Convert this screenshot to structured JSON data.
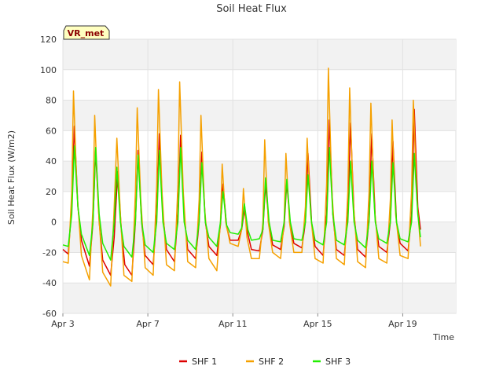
{
  "chart_data": {
    "type": "line",
    "title": "Soil Heat Flux",
    "xlabel": "Time",
    "ylabel": "Soil Heat Flux (W/m2)",
    "badge": "VR_met",
    "xlim": [
      "2024-03-03",
      "2024-03-21 12:00"
    ],
    "ylim": [
      -60,
      120
    ],
    "yticks": [
      -60,
      -40,
      -20,
      0,
      20,
      40,
      60,
      80,
      100,
      120
    ],
    "xticks": [
      {
        "date": "2024-03-03",
        "label": "Apr 3"
      },
      {
        "date": "2024-03-07",
        "label": "Apr 7"
      },
      {
        "date": "2024-03-11",
        "label": "Apr 11"
      },
      {
        "date": "2024-03-15",
        "label": "Apr 15"
      },
      {
        "date": "2024-03-19",
        "label": "Apr 19"
      }
    ],
    "grid": true,
    "banded_background": true,
    "legend_position": "bottom-center",
    "series": [
      {
        "name": "SHF 1",
        "color": "#dd0000",
        "points": [
          [
            "2024-03-03 00:00",
            -18
          ],
          [
            "2024-03-03 06:00",
            -21
          ],
          [
            "2024-03-03 10:00",
            10
          ],
          [
            "2024-03-03 13:00",
            63
          ],
          [
            "2024-03-03 17:00",
            10
          ],
          [
            "2024-03-03 21:00",
            -12
          ],
          [
            "2024-03-04 06:00",
            -29
          ],
          [
            "2024-03-04 10:00",
            0
          ],
          [
            "2024-03-04 13:00",
            47
          ],
          [
            "2024-03-04 17:00",
            0
          ],
          [
            "2024-03-04 21:00",
            -25
          ],
          [
            "2024-03-05 06:00",
            -35
          ],
          [
            "2024-03-05 10:00",
            -10
          ],
          [
            "2024-03-05 14:00",
            33
          ],
          [
            "2024-03-05 18:00",
            -5
          ],
          [
            "2024-03-05 22:00",
            -28
          ],
          [
            "2024-03-06 06:00",
            -35
          ],
          [
            "2024-03-06 10:00",
            0
          ],
          [
            "2024-03-06 13:00",
            47
          ],
          [
            "2024-03-06 17:00",
            0
          ],
          [
            "2024-03-06 21:00",
            -22
          ],
          [
            "2024-03-07 06:00",
            -28
          ],
          [
            "2024-03-07 10:00",
            5
          ],
          [
            "2024-03-07 13:00",
            58
          ],
          [
            "2024-03-07 17:00",
            5
          ],
          [
            "2024-03-07 21:00",
            -18
          ],
          [
            "2024-03-08 06:00",
            -26
          ],
          [
            "2024-03-08 10:00",
            5
          ],
          [
            "2024-03-08 13:00",
            57
          ],
          [
            "2024-03-08 17:00",
            5
          ],
          [
            "2024-03-08 21:00",
            -18
          ],
          [
            "2024-03-09 06:00",
            -24
          ],
          [
            "2024-03-09 10:00",
            0
          ],
          [
            "2024-03-09 13:00",
            46
          ],
          [
            "2024-03-09 17:00",
            0
          ],
          [
            "2024-03-09 21:00",
            -16
          ],
          [
            "2024-03-10 06:00",
            -22
          ],
          [
            "2024-03-10 10:00",
            -2
          ],
          [
            "2024-03-10 13:00",
            25
          ],
          [
            "2024-03-10 17:00",
            -3
          ],
          [
            "2024-03-10 21:00",
            -12
          ],
          [
            "2024-03-11 06:00",
            -12
          ],
          [
            "2024-03-11 10:00",
            -5
          ],
          [
            "2024-03-11 13:00",
            8
          ],
          [
            "2024-03-11 17:00",
            -8
          ],
          [
            "2024-03-11 21:00",
            -18
          ],
          [
            "2024-03-12 06:00",
            -19
          ],
          [
            "2024-03-12 10:00",
            -5
          ],
          [
            "2024-03-12 13:00",
            25
          ],
          [
            "2024-03-12 17:00",
            -2
          ],
          [
            "2024-03-12 21:00",
            -15
          ],
          [
            "2024-03-13 06:00",
            -18
          ],
          [
            "2024-03-13 10:00",
            -3
          ],
          [
            "2024-03-13 13:00",
            26
          ],
          [
            "2024-03-13 17:00",
            -2
          ],
          [
            "2024-03-13 21:00",
            -14
          ],
          [
            "2024-03-14 06:00",
            -17
          ],
          [
            "2024-03-14 10:00",
            0
          ],
          [
            "2024-03-14 13:00",
            45
          ],
          [
            "2024-03-14 17:00",
            0
          ],
          [
            "2024-03-14 21:00",
            -16
          ],
          [
            "2024-03-15 06:00",
            -22
          ],
          [
            "2024-03-15 10:00",
            5
          ],
          [
            "2024-03-15 13:00",
            67
          ],
          [
            "2024-03-15 17:00",
            5
          ],
          [
            "2024-03-15 21:00",
            -18
          ],
          [
            "2024-03-16 06:00",
            -22
          ],
          [
            "2024-03-16 10:00",
            5
          ],
          [
            "2024-03-16 13:00",
            65
          ],
          [
            "2024-03-16 17:00",
            5
          ],
          [
            "2024-03-16 21:00",
            -18
          ],
          [
            "2024-03-17 06:00",
            -23
          ],
          [
            "2024-03-17 10:00",
            2
          ],
          [
            "2024-03-17 13:00",
            58
          ],
          [
            "2024-03-17 17:00",
            2
          ],
          [
            "2024-03-17 21:00",
            -16
          ],
          [
            "2024-03-18 06:00",
            -20
          ],
          [
            "2024-03-18 10:00",
            0
          ],
          [
            "2024-03-18 13:00",
            53
          ],
          [
            "2024-03-18 17:00",
            0
          ],
          [
            "2024-03-18 21:00",
            -14
          ],
          [
            "2024-03-19 06:00",
            -19
          ],
          [
            "2024-03-19 10:00",
            5
          ],
          [
            "2024-03-19 13:00",
            74
          ],
          [
            "2024-03-19 17:00",
            10
          ],
          [
            "2024-03-19 20:00",
            -5
          ]
        ]
      },
      {
        "name": "SHF 2",
        "color": "#f5a000",
        "points": [
          [
            "2024-03-03 00:00",
            -26
          ],
          [
            "2024-03-03 06:00",
            -27
          ],
          [
            "2024-03-03 10:00",
            20
          ],
          [
            "2024-03-03 12:00",
            86
          ],
          [
            "2024-03-03 16:00",
            20
          ],
          [
            "2024-03-03 21:00",
            -22
          ],
          [
            "2024-03-04 06:00",
            -38
          ],
          [
            "2024-03-04 10:00",
            10
          ],
          [
            "2024-03-04 12:00",
            70
          ],
          [
            "2024-03-04 16:00",
            10
          ],
          [
            "2024-03-04 21:00",
            -33
          ],
          [
            "2024-03-05 06:00",
            -42
          ],
          [
            "2024-03-05 10:00",
            10
          ],
          [
            "2024-03-05 13:00",
            55
          ],
          [
            "2024-03-05 17:00",
            5
          ],
          [
            "2024-03-05 21:00",
            -35
          ],
          [
            "2024-03-06 06:00",
            -39
          ],
          [
            "2024-03-06 10:00",
            20
          ],
          [
            "2024-03-06 12:00",
            75
          ],
          [
            "2024-03-06 16:00",
            15
          ],
          [
            "2024-03-06 21:00",
            -30
          ],
          [
            "2024-03-07 06:00",
            -35
          ],
          [
            "2024-03-07 10:00",
            25
          ],
          [
            "2024-03-07 12:00",
            87
          ],
          [
            "2024-03-07 16:00",
            20
          ],
          [
            "2024-03-07 21:00",
            -28
          ],
          [
            "2024-03-08 06:00",
            -32
          ],
          [
            "2024-03-08 10:00",
            25
          ],
          [
            "2024-03-08 12:00",
            92
          ],
          [
            "2024-03-08 16:00",
            20
          ],
          [
            "2024-03-08 21:00",
            -26
          ],
          [
            "2024-03-09 06:00",
            -30
          ],
          [
            "2024-03-09 10:00",
            15
          ],
          [
            "2024-03-09 12:00",
            70
          ],
          [
            "2024-03-09 16:00",
            10
          ],
          [
            "2024-03-09 21:00",
            -24
          ],
          [
            "2024-03-10 06:00",
            -32
          ],
          [
            "2024-03-10 10:00",
            0
          ],
          [
            "2024-03-10 12:00",
            38
          ],
          [
            "2024-03-10 16:00",
            0
          ],
          [
            "2024-03-10 21:00",
            -14
          ],
          [
            "2024-03-11 06:00",
            -16
          ],
          [
            "2024-03-11 10:00",
            -5
          ],
          [
            "2024-03-11 12:00",
            22
          ],
          [
            "2024-03-11 16:00",
            -10
          ],
          [
            "2024-03-11 21:00",
            -24
          ],
          [
            "2024-03-12 06:00",
            -24
          ],
          [
            "2024-03-12 10:00",
            0
          ],
          [
            "2024-03-12 12:00",
            54
          ],
          [
            "2024-03-12 16:00",
            0
          ],
          [
            "2024-03-12 21:00",
            -20
          ],
          [
            "2024-03-13 06:00",
            -24
          ],
          [
            "2024-03-13 10:00",
            0
          ],
          [
            "2024-03-13 12:00",
            45
          ],
          [
            "2024-03-13 16:00",
            0
          ],
          [
            "2024-03-13 21:00",
            -20
          ],
          [
            "2024-03-14 06:00",
            -20
          ],
          [
            "2024-03-14 10:00",
            10
          ],
          [
            "2024-03-14 12:00",
            55
          ],
          [
            "2024-03-14 16:00",
            5
          ],
          [
            "2024-03-14 21:00",
            -24
          ],
          [
            "2024-03-15 06:00",
            -27
          ],
          [
            "2024-03-15 10:00",
            25
          ],
          [
            "2024-03-15 12:00",
            101
          ],
          [
            "2024-03-15 16:00",
            20
          ],
          [
            "2024-03-15 21:00",
            -24
          ],
          [
            "2024-03-16 06:00",
            -28
          ],
          [
            "2024-03-16 10:00",
            20
          ],
          [
            "2024-03-16 12:00",
            88
          ],
          [
            "2024-03-16 16:00",
            15
          ],
          [
            "2024-03-16 21:00",
            -26
          ],
          [
            "2024-03-17 06:00",
            -30
          ],
          [
            "2024-03-17 10:00",
            20
          ],
          [
            "2024-03-17 12:00",
            78
          ],
          [
            "2024-03-17 16:00",
            10
          ],
          [
            "2024-03-17 21:00",
            -24
          ],
          [
            "2024-03-18 06:00",
            -27
          ],
          [
            "2024-03-18 10:00",
            15
          ],
          [
            "2024-03-18 12:00",
            67
          ],
          [
            "2024-03-18 16:00",
            5
          ],
          [
            "2024-03-18 21:00",
            -22
          ],
          [
            "2024-03-19 06:00",
            -24
          ],
          [
            "2024-03-19 10:00",
            20
          ],
          [
            "2024-03-19 12:00",
            80
          ],
          [
            "2024-03-19 16:00",
            15
          ],
          [
            "2024-03-19 20:00",
            -16
          ]
        ]
      },
      {
        "name": "SHF 3",
        "color": "#22ee00",
        "points": [
          [
            "2024-03-03 00:00",
            -15
          ],
          [
            "2024-03-03 06:00",
            -16
          ],
          [
            "2024-03-03 10:00",
            5
          ],
          [
            "2024-03-03 13:00",
            50
          ],
          [
            "2024-03-03 17:00",
            10
          ],
          [
            "2024-03-03 21:00",
            -8
          ],
          [
            "2024-03-04 06:00",
            -22
          ],
          [
            "2024-03-04 10:00",
            0
          ],
          [
            "2024-03-04 13:00",
            49
          ],
          [
            "2024-03-04 17:00",
            5
          ],
          [
            "2024-03-04 21:00",
            -14
          ],
          [
            "2024-03-05 06:00",
            -25
          ],
          [
            "2024-03-05 10:00",
            0
          ],
          [
            "2024-03-05 13:00",
            36
          ],
          [
            "2024-03-05 17:00",
            0
          ],
          [
            "2024-03-05 21:00",
            -16
          ],
          [
            "2024-03-06 06:00",
            -23
          ],
          [
            "2024-03-06 10:00",
            0
          ],
          [
            "2024-03-06 13:00",
            44
          ],
          [
            "2024-03-06 17:00",
            0
          ],
          [
            "2024-03-06 21:00",
            -15
          ],
          [
            "2024-03-07 06:00",
            -20
          ],
          [
            "2024-03-07 10:00",
            0
          ],
          [
            "2024-03-07 13:00",
            47
          ],
          [
            "2024-03-07 17:00",
            0
          ],
          [
            "2024-03-07 21:00",
            -14
          ],
          [
            "2024-03-08 06:00",
            -18
          ],
          [
            "2024-03-08 10:00",
            0
          ],
          [
            "2024-03-08 13:00",
            49
          ],
          [
            "2024-03-08 17:00",
            0
          ],
          [
            "2024-03-08 21:00",
            -12
          ],
          [
            "2024-03-09 06:00",
            -18
          ],
          [
            "2024-03-09 10:00",
            0
          ],
          [
            "2024-03-09 13:00",
            39
          ],
          [
            "2024-03-09 17:00",
            0
          ],
          [
            "2024-03-09 21:00",
            -10
          ],
          [
            "2024-03-10 06:00",
            -16
          ],
          [
            "2024-03-10 10:00",
            0
          ],
          [
            "2024-03-10 13:00",
            20
          ],
          [
            "2024-03-10 17:00",
            -2
          ],
          [
            "2024-03-10 21:00",
            -7
          ],
          [
            "2024-03-11 06:00",
            -8
          ],
          [
            "2024-03-11 10:00",
            -4
          ],
          [
            "2024-03-11 13:00",
            12
          ],
          [
            "2024-03-11 17:00",
            -5
          ],
          [
            "2024-03-11 21:00",
            -12
          ],
          [
            "2024-03-12 06:00",
            -11
          ],
          [
            "2024-03-12 10:00",
            -5
          ],
          [
            "2024-03-12 13:00",
            29
          ],
          [
            "2024-03-12 17:00",
            0
          ],
          [
            "2024-03-12 21:00",
            -12
          ],
          [
            "2024-03-13 06:00",
            -13
          ],
          [
            "2024-03-13 10:00",
            0
          ],
          [
            "2024-03-13 13:00",
            28
          ],
          [
            "2024-03-13 17:00",
            0
          ],
          [
            "2024-03-13 21:00",
            -11
          ],
          [
            "2024-03-14 06:00",
            -12
          ],
          [
            "2024-03-14 10:00",
            0
          ],
          [
            "2024-03-14 13:00",
            31
          ],
          [
            "2024-03-14 17:00",
            0
          ],
          [
            "2024-03-14 21:00",
            -12
          ],
          [
            "2024-03-15 06:00",
            -15
          ],
          [
            "2024-03-15 10:00",
            0
          ],
          [
            "2024-03-15 13:00",
            49
          ],
          [
            "2024-03-15 17:00",
            5
          ],
          [
            "2024-03-15 21:00",
            -12
          ],
          [
            "2024-03-16 06:00",
            -15
          ],
          [
            "2024-03-16 10:00",
            0
          ],
          [
            "2024-03-16 13:00",
            40
          ],
          [
            "2024-03-16 17:00",
            0
          ],
          [
            "2024-03-16 21:00",
            -12
          ],
          [
            "2024-03-17 06:00",
            -17
          ],
          [
            "2024-03-17 10:00",
            0
          ],
          [
            "2024-03-17 13:00",
            40
          ],
          [
            "2024-03-17 17:00",
            0
          ],
          [
            "2024-03-17 21:00",
            -11
          ],
          [
            "2024-03-18 06:00",
            -14
          ],
          [
            "2024-03-18 10:00",
            0
          ],
          [
            "2024-03-18 13:00",
            39
          ],
          [
            "2024-03-18 17:00",
            0
          ],
          [
            "2024-03-18 21:00",
            -11
          ],
          [
            "2024-03-19 06:00",
            -13
          ],
          [
            "2024-03-19 10:00",
            0
          ],
          [
            "2024-03-19 13:00",
            45
          ],
          [
            "2024-03-19 17:00",
            5
          ],
          [
            "2024-03-19 20:00",
            -10
          ]
        ]
      }
    ]
  }
}
